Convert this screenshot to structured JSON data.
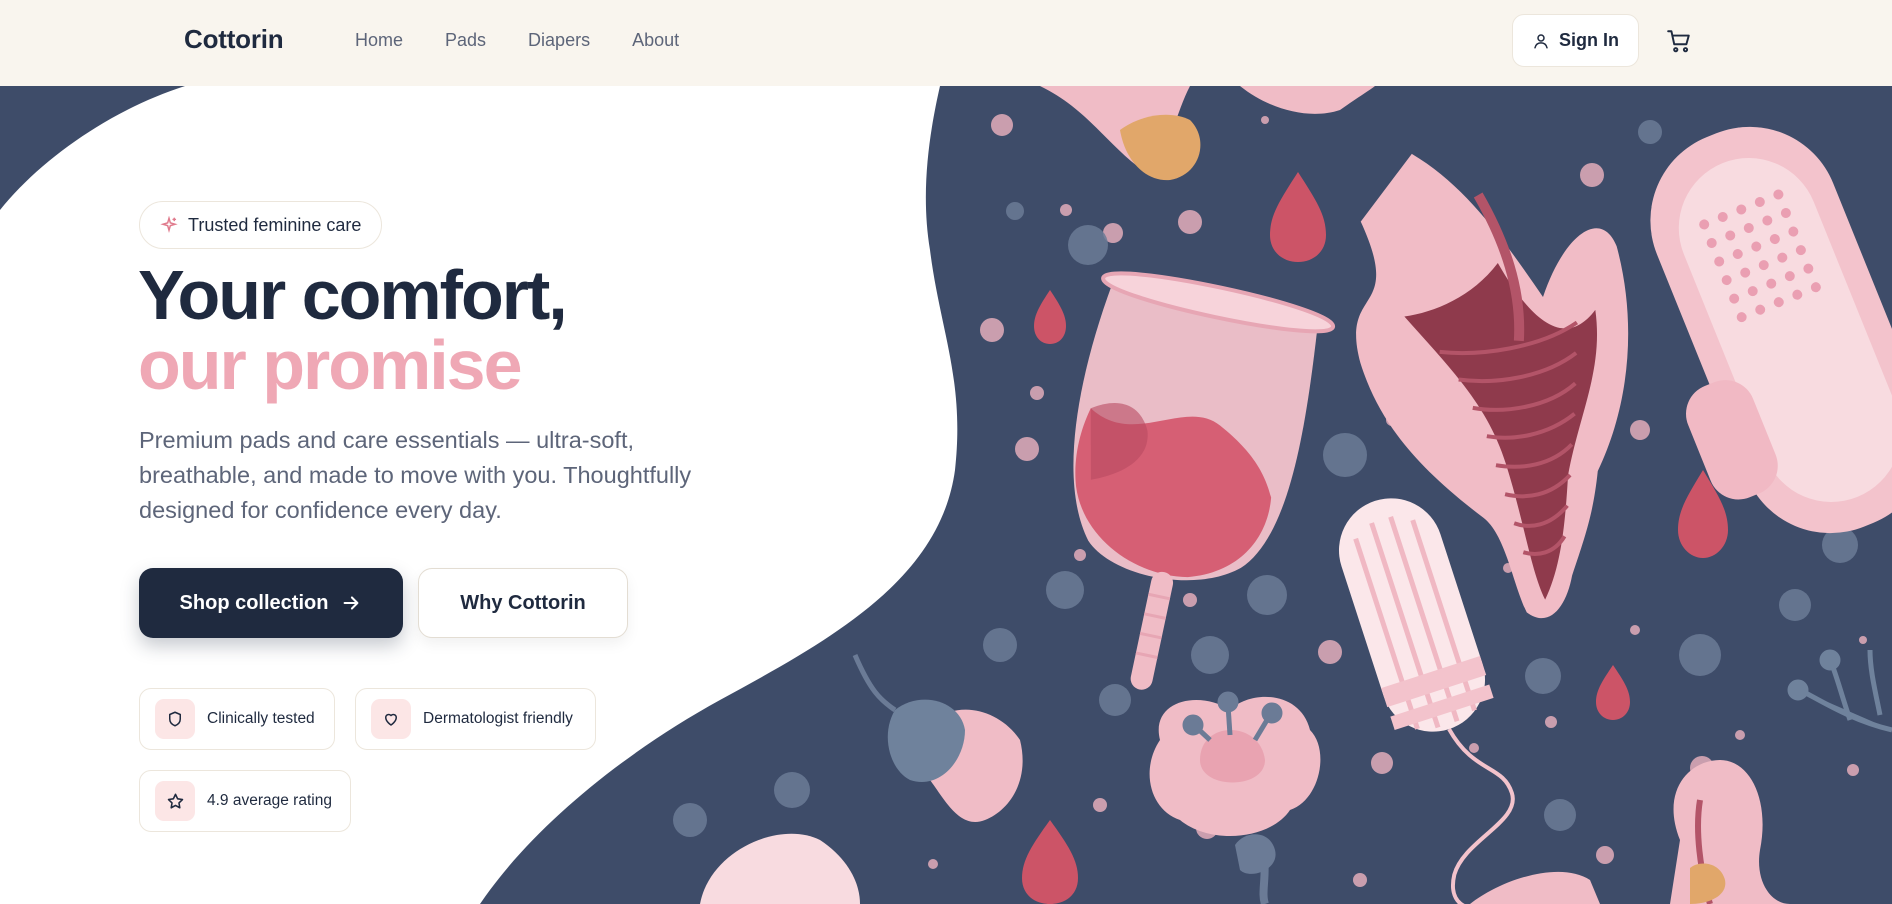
{
  "brand": {
    "name": "Cottorin"
  },
  "nav": {
    "items": [
      {
        "label": "Home"
      },
      {
        "label": "Pads"
      },
      {
        "label": "Diapers"
      },
      {
        "label": "About"
      }
    ]
  },
  "header": {
    "signin_label": "Sign In",
    "signin_icon": "user-icon",
    "cart_icon": "cart-icon"
  },
  "hero": {
    "badge": "Trusted feminine care",
    "badge_icon": "sparkle-icon",
    "title_line1": "Your comfort,",
    "title_line2": "our promise",
    "description": "Premium pads and care essentials — ultra-soft, breathable, and made to move with you. Thoughtfully designed for confidence every day.",
    "primary_cta": "Shop collection",
    "secondary_cta": "Why Cottorin",
    "features": [
      {
        "label": "Clinically tested",
        "icon": "shield-icon"
      },
      {
        "label": "Dermatologist friendly",
        "icon": "heart-icon"
      },
      {
        "label": "4.9 average rating",
        "icon": "star-icon"
      }
    ]
  },
  "colors": {
    "navy": "#1f2a3f",
    "pink": "#efa8b5",
    "art_background": "#3e4c69",
    "header_bg": "#f9f5ee"
  }
}
